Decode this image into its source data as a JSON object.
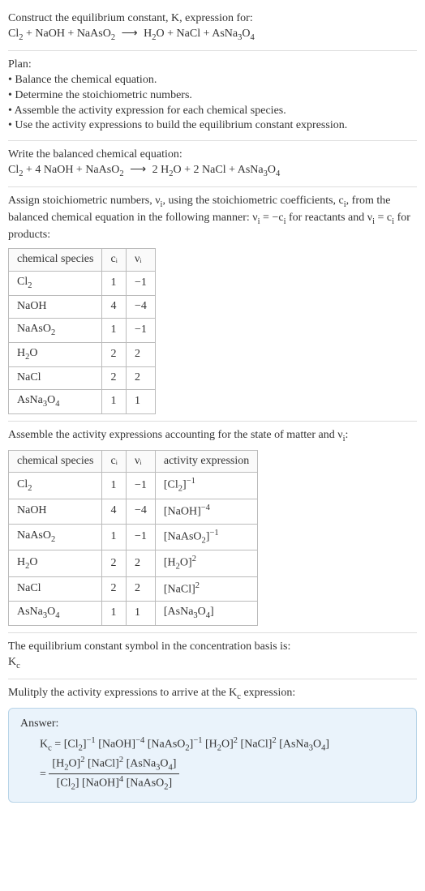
{
  "intro": {
    "line1": "Construct the equilibrium constant, K, expression for:",
    "eq_lhs_parts": [
      "Cl",
      "2",
      " + NaOH + NaAsO",
      "2"
    ],
    "arrow": " ⟶ ",
    "eq_rhs_parts": [
      "H",
      "2",
      "O + NaCl + AsNa",
      "3",
      "O",
      "4"
    ]
  },
  "plan": {
    "heading": "Plan:",
    "items": [
      "• Balance the chemical equation.",
      "• Determine the stoichiometric numbers.",
      "• Assemble the activity expression for each chemical species.",
      "• Use the activity expressions to build the equilibrium constant expression."
    ]
  },
  "balanced": {
    "heading": "Write the balanced chemical equation:",
    "lhs_parts": [
      "Cl",
      "2",
      " + 4 NaOH + NaAsO",
      "2"
    ],
    "arrow": " ⟶ ",
    "rhs_parts": [
      "2 H",
      "2",
      "O + 2 NaCl + AsNa",
      "3",
      "O",
      "4"
    ]
  },
  "stoich": {
    "text_parts": [
      "Assign stoichiometric numbers, ν",
      "i",
      ", using the stoichiometric coefficients, c",
      "i",
      ", from the balanced chemical equation in the following manner: ν",
      "i",
      " = −c",
      "i",
      " for reactants and ν",
      "i",
      " = c",
      "i",
      " for products:"
    ],
    "headers": [
      "chemical species",
      "cᵢ",
      "νᵢ"
    ],
    "rows": [
      {
        "species": [
          "Cl",
          "2"
        ],
        "c": "1",
        "v": "−1"
      },
      {
        "species": [
          "NaOH"
        ],
        "c": "4",
        "v": "−4"
      },
      {
        "species": [
          "NaAsO",
          "2"
        ],
        "c": "1",
        "v": "−1"
      },
      {
        "species": [
          "H",
          "2",
          "O"
        ],
        "c": "2",
        "v": "2"
      },
      {
        "species": [
          "NaCl"
        ],
        "c": "2",
        "v": "2"
      },
      {
        "species": [
          "AsNa",
          "3",
          "O",
          "4"
        ],
        "c": "1",
        "v": "1"
      }
    ]
  },
  "activity": {
    "text_parts": [
      "Assemble the activity expressions accounting for the state of matter and ν",
      "i",
      ":"
    ],
    "headers": [
      "chemical species",
      "cᵢ",
      "νᵢ",
      "activity expression"
    ],
    "rows": [
      {
        "species": [
          "Cl",
          "2"
        ],
        "c": "1",
        "v": "−1",
        "expr": [
          "[Cl",
          "2",
          "]",
          "−1"
        ]
      },
      {
        "species": [
          "NaOH"
        ],
        "c": "4",
        "v": "−4",
        "expr": [
          "[NaOH]",
          "",
          "",
          "−4"
        ]
      },
      {
        "species": [
          "NaAsO",
          "2"
        ],
        "c": "1",
        "v": "−1",
        "expr": [
          "[NaAsO",
          "2",
          "]",
          "−1"
        ]
      },
      {
        "species": [
          "H",
          "2",
          "O"
        ],
        "c": "2",
        "v": "2",
        "expr": [
          "[H",
          "2",
          "O]",
          "2"
        ]
      },
      {
        "species": [
          "NaCl"
        ],
        "c": "2",
        "v": "2",
        "expr": [
          "[NaCl]",
          "",
          "",
          "2"
        ]
      },
      {
        "species": [
          "AsNa",
          "3",
          "O",
          "4"
        ],
        "c": "1",
        "v": "1",
        "expr": [
          "[AsNa",
          "3",
          "O",
          "4",
          "]",
          ""
        ]
      }
    ]
  },
  "kc_symbol": {
    "line1": "The equilibrium constant symbol in the concentration basis is:",
    "symbol_base": "K",
    "symbol_sub": "c"
  },
  "multiply": {
    "text_parts": [
      "Mulitply the activity expressions to arrive at the K",
      "c",
      " expression:"
    ]
  },
  "answer": {
    "label": "Answer:",
    "line1": {
      "prefix_base": "K",
      "prefix_sub": "c",
      "equals": " = ",
      "terms": [
        {
          "b": "[Cl",
          "s": "2",
          "b2": "]",
          "e": "−1"
        },
        {
          "b": " [NaOH]",
          "s": "",
          "b2": "",
          "e": "−4"
        },
        {
          "b": " [NaAsO",
          "s": "2",
          "b2": "]",
          "e": "−1"
        },
        {
          "b": " [H",
          "s": "2",
          "b2": "O]",
          "e": "2"
        },
        {
          "b": " [NaCl]",
          "s": "",
          "b2": "",
          "e": "2"
        },
        {
          "b": " [AsNa",
          "s": "3",
          "b2": "O",
          "s2": "4",
          "b3": "]",
          "e": ""
        }
      ]
    },
    "line2": {
      "equals": "= ",
      "num": [
        {
          "b": "[H",
          "s": "2",
          "b2": "O]",
          "e": "2"
        },
        {
          "b": " [NaCl]",
          "s": "",
          "b2": "",
          "e": "2"
        },
        {
          "b": " [AsNa",
          "s": "3",
          "b2": "O",
          "s2": "4",
          "b3": "]",
          "e": ""
        }
      ],
      "den": [
        {
          "b": "[Cl",
          "s": "2",
          "b2": "]",
          "e": ""
        },
        {
          "b": " [NaOH]",
          "s": "",
          "b2": "",
          "e": "4"
        },
        {
          "b": " [NaAsO",
          "s": "2",
          "b2": "]",
          "e": ""
        }
      ]
    }
  }
}
